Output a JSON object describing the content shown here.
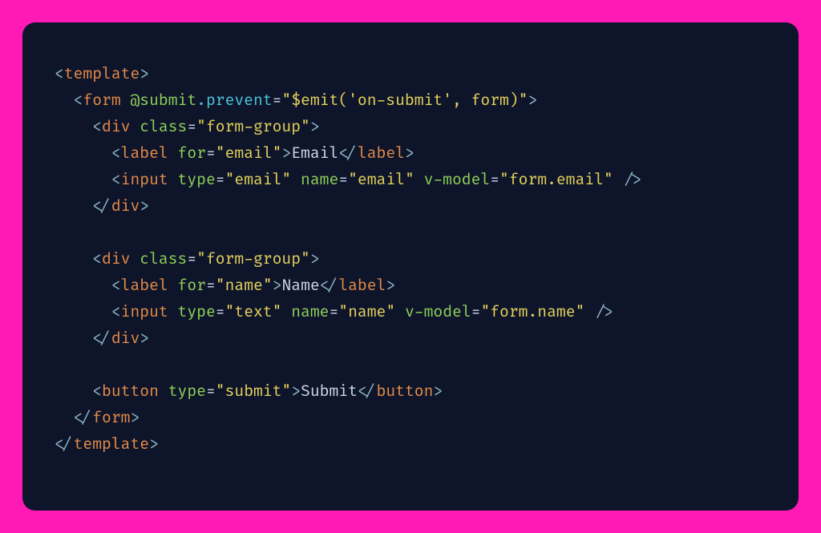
{
  "colors": {
    "page_bg": "#ff19b5",
    "panel_bg": "#0e152b",
    "punctuation": "#8bb3c0",
    "tag": "#e58c47",
    "attribute": "#8fd158",
    "string": "#e6d35a",
    "keyword": "#4dc5d9",
    "text": "#cfd7ea"
  },
  "code": {
    "lines": [
      [
        {
          "cls": "pn",
          "t": "<"
        },
        {
          "cls": "tg",
          "t": "template"
        },
        {
          "cls": "pn",
          "t": ">"
        }
      ],
      [
        {
          "cls": "tx",
          "t": "  "
        },
        {
          "cls": "pn",
          "t": "<"
        },
        {
          "cls": "tg",
          "t": "form"
        },
        {
          "cls": "tx",
          "t": " "
        },
        {
          "cls": "at",
          "t": "@submit"
        },
        {
          "cls": "fn",
          "t": ".prevent"
        },
        {
          "cls": "eq",
          "t": "="
        },
        {
          "cls": "sv",
          "t": "\"$emit('on-submit', form)\""
        },
        {
          "cls": "pn",
          "t": ">"
        }
      ],
      [
        {
          "cls": "tx",
          "t": "    "
        },
        {
          "cls": "pn",
          "t": "<"
        },
        {
          "cls": "tg",
          "t": "div"
        },
        {
          "cls": "tx",
          "t": " "
        },
        {
          "cls": "at",
          "t": "class"
        },
        {
          "cls": "eq",
          "t": "="
        },
        {
          "cls": "sv",
          "t": "\"form-group\""
        },
        {
          "cls": "pn",
          "t": ">"
        }
      ],
      [
        {
          "cls": "tx",
          "t": "      "
        },
        {
          "cls": "pn",
          "t": "<"
        },
        {
          "cls": "tg",
          "t": "label"
        },
        {
          "cls": "tx",
          "t": " "
        },
        {
          "cls": "at",
          "t": "for"
        },
        {
          "cls": "eq",
          "t": "="
        },
        {
          "cls": "sv",
          "t": "\"email\""
        },
        {
          "cls": "pn",
          "t": ">"
        },
        {
          "cls": "tx",
          "t": "Email"
        },
        {
          "cls": "pn",
          "t": "</"
        },
        {
          "cls": "tg",
          "t": "label"
        },
        {
          "cls": "pn",
          "t": ">"
        }
      ],
      [
        {
          "cls": "tx",
          "t": "      "
        },
        {
          "cls": "pn",
          "t": "<"
        },
        {
          "cls": "tg",
          "t": "input"
        },
        {
          "cls": "tx",
          "t": " "
        },
        {
          "cls": "at",
          "t": "type"
        },
        {
          "cls": "eq",
          "t": "="
        },
        {
          "cls": "sv",
          "t": "\"email\""
        },
        {
          "cls": "tx",
          "t": " "
        },
        {
          "cls": "at",
          "t": "name"
        },
        {
          "cls": "eq",
          "t": "="
        },
        {
          "cls": "sv",
          "t": "\"email\""
        },
        {
          "cls": "tx",
          "t": " "
        },
        {
          "cls": "at",
          "t": "v-model"
        },
        {
          "cls": "eq",
          "t": "="
        },
        {
          "cls": "sv",
          "t": "\"form.email\""
        },
        {
          "cls": "tx",
          "t": " "
        },
        {
          "cls": "pn",
          "t": "/>"
        }
      ],
      [
        {
          "cls": "tx",
          "t": "    "
        },
        {
          "cls": "pn",
          "t": "</"
        },
        {
          "cls": "tg",
          "t": "div"
        },
        {
          "cls": "pn",
          "t": ">"
        }
      ],
      [
        {
          "cls": "tx",
          "t": " "
        }
      ],
      [
        {
          "cls": "tx",
          "t": "    "
        },
        {
          "cls": "pn",
          "t": "<"
        },
        {
          "cls": "tg",
          "t": "div"
        },
        {
          "cls": "tx",
          "t": " "
        },
        {
          "cls": "at",
          "t": "class"
        },
        {
          "cls": "eq",
          "t": "="
        },
        {
          "cls": "sv",
          "t": "\"form-group\""
        },
        {
          "cls": "pn",
          "t": ">"
        }
      ],
      [
        {
          "cls": "tx",
          "t": "      "
        },
        {
          "cls": "pn",
          "t": "<"
        },
        {
          "cls": "tg",
          "t": "label"
        },
        {
          "cls": "tx",
          "t": " "
        },
        {
          "cls": "at",
          "t": "for"
        },
        {
          "cls": "eq",
          "t": "="
        },
        {
          "cls": "sv",
          "t": "\"name\""
        },
        {
          "cls": "pn",
          "t": ">"
        },
        {
          "cls": "tx",
          "t": "Name"
        },
        {
          "cls": "pn",
          "t": "</"
        },
        {
          "cls": "tg",
          "t": "label"
        },
        {
          "cls": "pn",
          "t": ">"
        }
      ],
      [
        {
          "cls": "tx",
          "t": "      "
        },
        {
          "cls": "pn",
          "t": "<"
        },
        {
          "cls": "tg",
          "t": "input"
        },
        {
          "cls": "tx",
          "t": " "
        },
        {
          "cls": "at",
          "t": "type"
        },
        {
          "cls": "eq",
          "t": "="
        },
        {
          "cls": "sv",
          "t": "\"text\""
        },
        {
          "cls": "tx",
          "t": " "
        },
        {
          "cls": "at",
          "t": "name"
        },
        {
          "cls": "eq",
          "t": "="
        },
        {
          "cls": "sv",
          "t": "\"name\""
        },
        {
          "cls": "tx",
          "t": " "
        },
        {
          "cls": "at",
          "t": "v-model"
        },
        {
          "cls": "eq",
          "t": "="
        },
        {
          "cls": "sv",
          "t": "\"form.name\""
        },
        {
          "cls": "tx",
          "t": " "
        },
        {
          "cls": "pn",
          "t": "/>"
        }
      ],
      [
        {
          "cls": "tx",
          "t": "    "
        },
        {
          "cls": "pn",
          "t": "</"
        },
        {
          "cls": "tg",
          "t": "div"
        },
        {
          "cls": "pn",
          "t": ">"
        }
      ],
      [
        {
          "cls": "tx",
          "t": " "
        }
      ],
      [
        {
          "cls": "tx",
          "t": "    "
        },
        {
          "cls": "pn",
          "t": "<"
        },
        {
          "cls": "tg",
          "t": "button"
        },
        {
          "cls": "tx",
          "t": " "
        },
        {
          "cls": "at",
          "t": "type"
        },
        {
          "cls": "eq",
          "t": "="
        },
        {
          "cls": "sv",
          "t": "\"submit\""
        },
        {
          "cls": "pn",
          "t": ">"
        },
        {
          "cls": "tx",
          "t": "Submit"
        },
        {
          "cls": "pn",
          "t": "</"
        },
        {
          "cls": "tg",
          "t": "button"
        },
        {
          "cls": "pn",
          "t": ">"
        }
      ],
      [
        {
          "cls": "tx",
          "t": "  "
        },
        {
          "cls": "pn",
          "t": "</"
        },
        {
          "cls": "tg",
          "t": "form"
        },
        {
          "cls": "pn",
          "t": ">"
        }
      ],
      [
        {
          "cls": "pn",
          "t": "</"
        },
        {
          "cls": "tg",
          "t": "template"
        },
        {
          "cls": "pn",
          "t": ">"
        }
      ]
    ]
  }
}
